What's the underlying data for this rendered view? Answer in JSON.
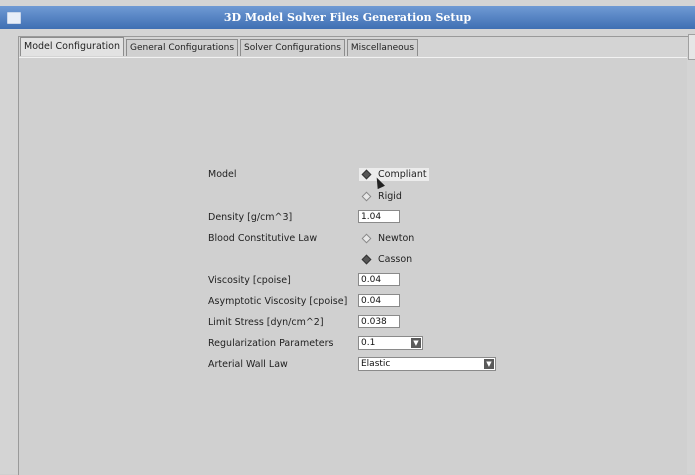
{
  "window": {
    "title": "3D Model Solver Files Generation Setup"
  },
  "tabs": [
    {
      "label": "Model Configuration"
    },
    {
      "label": "General Configurations"
    },
    {
      "label": "Solver Configurations"
    },
    {
      "label": "Miscellaneous"
    }
  ],
  "form": {
    "model": {
      "label": "Model",
      "options": [
        {
          "label": "Compliant",
          "selected": true
        },
        {
          "label": "Rigid",
          "selected": false
        }
      ]
    },
    "density": {
      "label": "Density [g/cm^3]",
      "value": "1.04"
    },
    "blood_law": {
      "label": "Blood Constitutive Law",
      "options": [
        {
          "label": "Newton",
          "selected": false
        },
        {
          "label": "Casson",
          "selected": true
        }
      ]
    },
    "viscosity": {
      "label": "Viscosity [cpoise]",
      "value": "0.04"
    },
    "asymptotic_viscosity": {
      "label": "Asymptotic Viscosity [cpoise]",
      "value": "0.04"
    },
    "limit_stress": {
      "label": "Limit Stress [dyn/cm^2]",
      "value": "0.038"
    },
    "regularization": {
      "label": "Regularization Parameters",
      "value": "0.1"
    },
    "arterial_wall_law": {
      "label": "Arterial Wall Law",
      "value": "Elastic"
    }
  }
}
